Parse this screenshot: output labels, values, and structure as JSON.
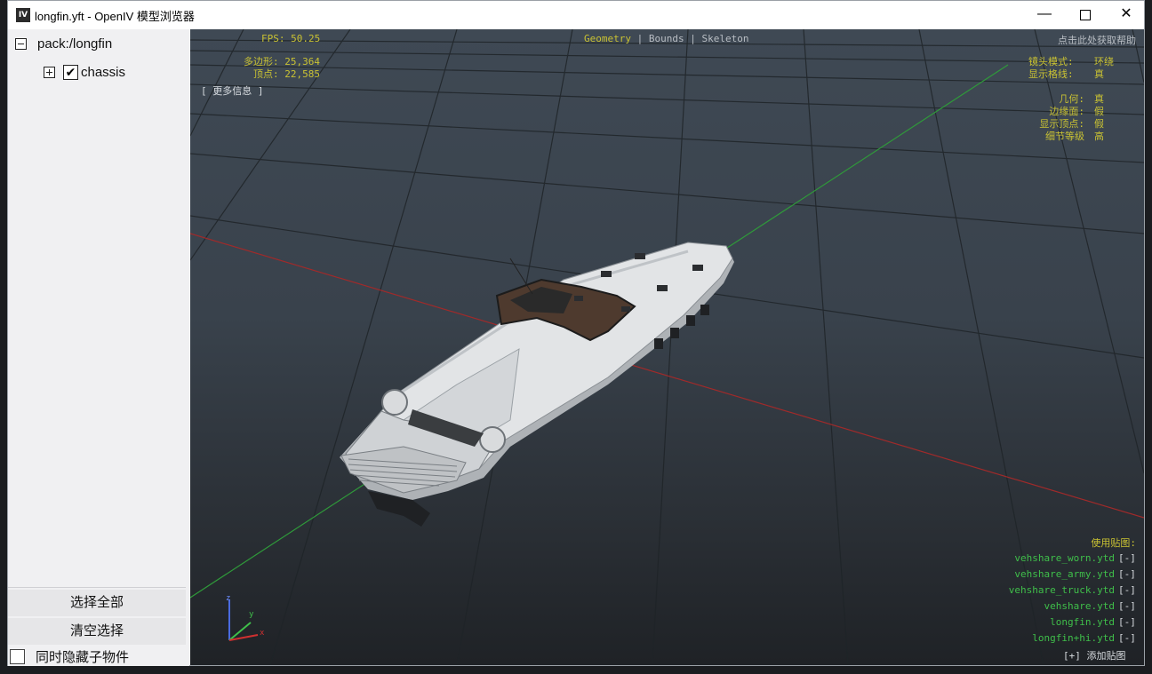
{
  "window": {
    "icon_text": "IV",
    "title": "longfin.yft - OpenIV 模型浏览器",
    "minimize": "—",
    "close": "✕"
  },
  "sidebar": {
    "root_label": "pack:/longfin",
    "child_label": "chassis",
    "child_checked": true,
    "check_glyph": "✔",
    "select_all": "选择全部",
    "clear_selection": "清空选择",
    "hide_children": "同时隐藏子物件"
  },
  "hud": {
    "fps": "FPS: 50.25",
    "polygons": "多边形:  25,364",
    "vertices": "顶点:  22,585",
    "more_info": "[ 更多信息 ]",
    "tab_geometry": "Geometry",
    "tab_sep1": "|",
    "tab_bounds": "Bounds",
    "tab_sep2": "|",
    "tab_skeleton": "Skeleton",
    "help": "点击此处获取帮助",
    "camera_mode_label": "镜头模式:",
    "camera_mode_value": "环绕",
    "show_grid_label": "显示格线:",
    "show_grid_value": "真",
    "geometry_label": "几何:",
    "geometry_value": "真",
    "edges_label": "边缘面:",
    "edges_value": "假",
    "show_vertices_label": "显示顶点:",
    "show_vertices_value": "假",
    "lod_label": "细节等级",
    "lod_value": "高",
    "textures_title": "使用贴图:",
    "textures": [
      {
        "name": "vehshare_worn.ytd",
        "action": "[-]"
      },
      {
        "name": "vehshare_army.ytd",
        "action": "[-]"
      },
      {
        "name": "vehshare_truck.ytd",
        "action": "[-]"
      },
      {
        "name": "vehshare.ytd",
        "action": "[-]"
      },
      {
        "name": "longfin.ytd",
        "action": "[-]"
      },
      {
        "name": "longfin+hi.ytd",
        "action": "[-]"
      }
    ],
    "add_texture_bracket": "[+]",
    "add_texture_label": "添加贴图",
    "axis_x": "x",
    "axis_y": "y",
    "axis_z": "z"
  },
  "colors": {
    "hud_yellow": "#c9c233",
    "hud_green": "#3fbf4a",
    "axis_red": "#b02a2a",
    "axis_green": "#2f9a3a"
  }
}
